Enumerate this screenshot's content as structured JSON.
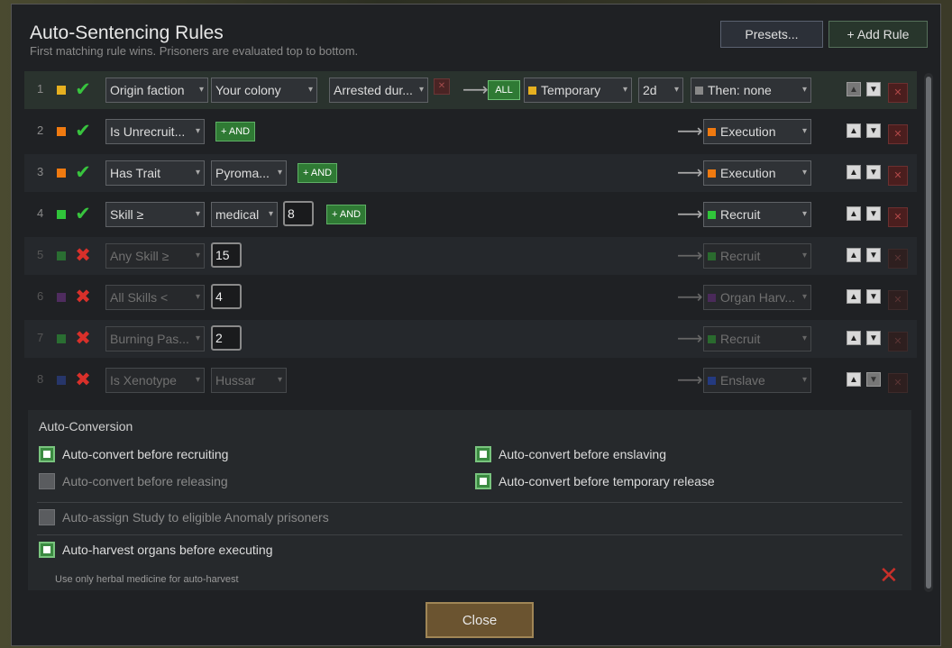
{
  "dialog": {
    "title": "Auto-Sentencing Rules",
    "subtitle": "First matching rule wins. Prisoners are evaluated top to bottom.",
    "presets_label": "Presets...",
    "add_rule_label": "+ Add Rule",
    "close_label": "Close"
  },
  "colors": {
    "yellow": "#e6b020",
    "orange": "#f07a10",
    "green": "#30c43a",
    "purple": "#8a3aa8",
    "blue": "#3050c0"
  },
  "rules": [
    {
      "num": "1",
      "enabled": true,
      "color": "yellow",
      "cond1": "Origin faction",
      "cond2": "Your colony",
      "cond3": "Arrested dur...",
      "all": "ALL",
      "action": "Temporary",
      "duration": "2d",
      "then": "Then: none"
    },
    {
      "num": "2",
      "enabled": true,
      "color": "orange",
      "cond1": "Is Unrecruit...",
      "and": "+ AND",
      "action": "Execution"
    },
    {
      "num": "3",
      "enabled": true,
      "color": "orange",
      "cond1": "Has Trait",
      "cond2": "Pyroma...",
      "and": "+ AND",
      "action": "Execution"
    },
    {
      "num": "4",
      "enabled": true,
      "color": "green",
      "cond1": "Skill ≥",
      "cond2": "medical",
      "value": "8",
      "and": "+ AND",
      "action": "Recruit"
    },
    {
      "num": "5",
      "enabled": false,
      "color": "green",
      "cond1": "Any Skill ≥",
      "value": "15",
      "action": "Recruit"
    },
    {
      "num": "6",
      "enabled": false,
      "color": "purple",
      "cond1": "All Skills <",
      "value": "4",
      "action": "Organ Harv..."
    },
    {
      "num": "7",
      "enabled": false,
      "color": "green",
      "cond1": "Burning Pas...",
      "value": "2",
      "action": "Recruit"
    },
    {
      "num": "8",
      "enabled": false,
      "color": "blue",
      "cond1": "Is Xenotype",
      "cond2": "Hussar",
      "action": "Enslave"
    }
  ],
  "conversion": {
    "title": "Auto-Conversion",
    "before_recruiting": "Auto-convert before recruiting",
    "before_enslaving": "Auto-convert before enslaving",
    "before_releasing": "Auto-convert before releasing",
    "before_temporary": "Auto-convert before temporary release",
    "assign_study": "Auto-assign Study to eligible Anomaly prisoners",
    "harvest_organs": "Auto-harvest organs before executing",
    "herbal_note": "Use only herbal medicine for auto-harvest"
  }
}
